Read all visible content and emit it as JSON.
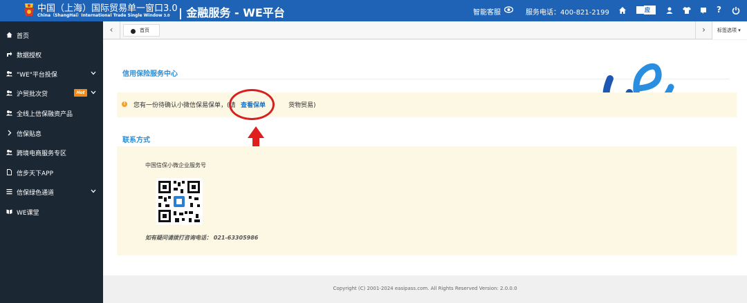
{
  "header": {
    "logo_cn": "中国（上海）国际贸易单一窗口",
    "logo_ver": "3.0",
    "logo_en": "China（ShangHai）International  Trade Single Window",
    "logo_en_ver": "3.0",
    "brand_title": "| 金融服务 - WE平台",
    "assistant_label": "智能客服",
    "hotline": "服务电话：400-821-2199",
    "apps_label": "应用",
    "help": "?"
  },
  "sidebar": {
    "items": [
      {
        "label": "首页",
        "icon": "home-icon"
      },
      {
        "label": "数据授权",
        "icon": "share-icon"
      },
      {
        "label": "\"WE\"平台投保",
        "icon": "users-icon"
      },
      {
        "label": "沪贸批次贷",
        "icon": "users-icon",
        "badge": "Hot"
      },
      {
        "label": "全线上信保融资产品",
        "icon": "users-icon"
      },
      {
        "label": "信保贴息",
        "icon": "chevron-right-icon"
      },
      {
        "label": "跨境电商服务专区",
        "icon": "users-icon"
      },
      {
        "label": "信步天下APP",
        "icon": "file-icon"
      },
      {
        "label": "信保绿色通道",
        "icon": "list-icon"
      },
      {
        "label": "WE课堂",
        "icon": "book-icon"
      }
    ]
  },
  "tabs": {
    "home": "首页",
    "options": "标签选项"
  },
  "main": {
    "section_title": "信用保险服务中心",
    "alert_text": "您有一份待确认小微信保易保单，(请",
    "alert_link": "查看保单",
    "alert_tail": "货物贸易)",
    "contact_title": "联系方式",
    "contact_org": "中国信保小微企业服务号",
    "contact_phone": "如有疑问请拨打咨询电话：  021-63305986"
  },
  "footer": {
    "copyright": "Copyright (C) 2001-2024 easipass.com. All Rights Reserved Version: 2.0.0.0"
  },
  "colors": {
    "header_bg": "#1f63b7",
    "sidebar_bg": "#1b2733",
    "accent": "#2f8dd3",
    "annotation": "#d61f1f",
    "alert_bg": "#fcf8e3"
  }
}
